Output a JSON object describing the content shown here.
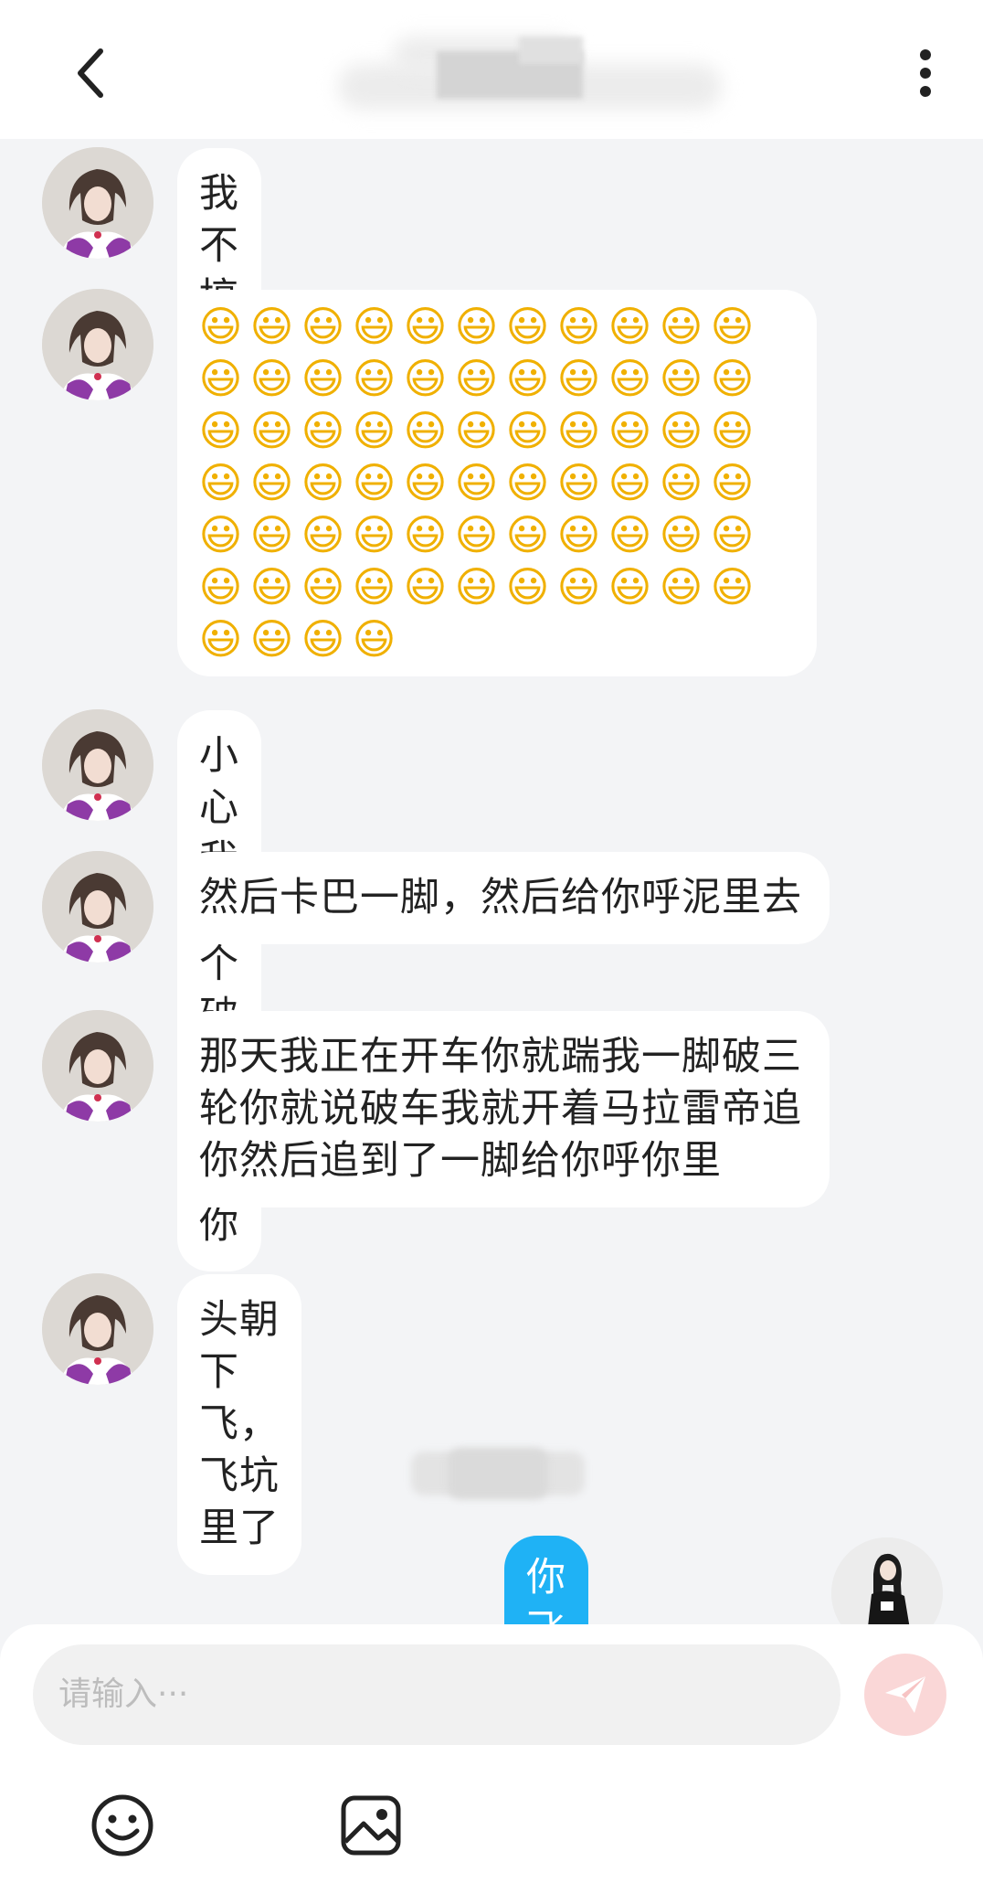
{
  "header": {
    "back_icon": "chevron-left-icon",
    "more_icon": "more-vertical-icon",
    "title_redacted": true
  },
  "messages": [
    {
      "sender": "incoming",
      "text": "我不搞笑"
    },
    {
      "sender": "incoming",
      "emoji": "😃",
      "emoji_count": 70
    },
    {
      "sender": "incoming",
      "text": "小心我开个破三轮追你"
    },
    {
      "sender": "incoming",
      "text": "然后卡巴一脚，然后给你呼泥里去"
    },
    {
      "sender": "incoming",
      "text": "那天我正在开车你就踹我一脚破三轮你就说破车我就开着马拉雷帝追你然后追到了一脚给你呼你里"
    },
    {
      "sender": "incoming",
      "text": "头朝下飞，飞坑里了"
    },
    {
      "sender": "outgoing",
      "text": "你飞粪坑里了"
    }
  ],
  "composer": {
    "placeholder": "请输入···",
    "send_icon": "paper-plane-icon",
    "emoji_icon": "smiley-icon",
    "image_icon": "image-icon"
  },
  "colors": {
    "background": "#f3f4f6",
    "incoming_bubble": "#ffffff",
    "outgoing_bubble": "#1fb2f5",
    "send_button": "#fad7d7"
  }
}
